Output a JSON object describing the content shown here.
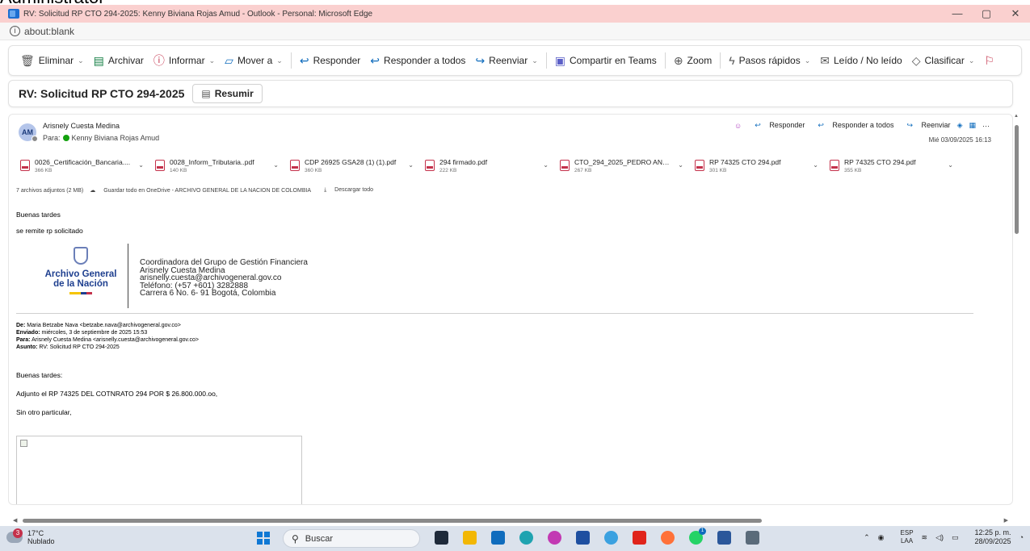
{
  "cutoff_text": "Administrator",
  "window": {
    "title": "RV: Solicitud RP CTO 294-2025: Kenny Biviana Rojas Amud - Outlook - Personal: Microsoft Edge",
    "address": "about:blank",
    "minimize": "—",
    "restore": "▢",
    "close": "✕"
  },
  "toolbar": {
    "delete": "Eliminar",
    "archive": "Archivar",
    "report": "Informar",
    "move": "Mover a",
    "reply": "Responder",
    "reply_all": "Responder a todos",
    "forward": "Reenviar",
    "teams": "Compartir en Teams",
    "zoom": "Zoom",
    "quick_steps": "Pasos rápidos",
    "read_unread": "Leído / No leído",
    "categorize": "Clasificar"
  },
  "subject": "RV: Solicitud RP CTO 294-2025",
  "summarize_label": "Resumir",
  "message": {
    "avatar": "AM",
    "sender": "Arisnely Cuesta Medina",
    "to_prefix": "Para:",
    "to": "Kenny Biviana Rojas Amud",
    "date": "Mié 03/09/2025 16:13",
    "actions": {
      "reply": "Responder",
      "reply_all": "Responder a todos",
      "forward": "Reenviar"
    }
  },
  "attachments": [
    {
      "name": "0026_Certificación_Bancaria....",
      "size": "366 KB"
    },
    {
      "name": "0028_Inform_Tributaria..pdf",
      "size": "140 KB"
    },
    {
      "name": "CDP 26925 GSA28 (1) (1).pdf",
      "size": "360 KB"
    },
    {
      "name": "294 firmado.pdf",
      "size": "222 KB"
    },
    {
      "name": "CTO_294_2025_PEDRO AND...",
      "size": "267 KB"
    },
    {
      "name": "RP 74325 CTO 294.pdf",
      "size": "301 KB"
    },
    {
      "name": "RP 74325 CTO 294.pdf",
      "size": "355 KB"
    }
  ],
  "attachment_summary": {
    "count": "7 archivos adjuntos (2 MB)",
    "save": "Guardar todo en OneDrive - ARCHIVO GENERAL DE LA NACION DE COLOMBIA",
    "download": "Descargar todo"
  },
  "body": {
    "greeting": "Buenas tardes",
    "line1": "se remite rp solicitado"
  },
  "signature": {
    "logo_line1": "Archivo General",
    "logo_line2": "de la Nación",
    "role": "Coordinadora del Grupo de Gestión Financiera",
    "name": "Arisnely Cuesta Medina",
    "email": "arisnelly.cuesta@archivogeneral.gov.co",
    "phone": "Teléfono: (+57 +601) 3282888",
    "address": "Carrera 6 No. 6- 91 Bogotá, Colombia"
  },
  "forwarded": {
    "from_label": "De:",
    "from": "Maria Betzabe Nava <betzabe.nava@archivogeneral.gov.co>",
    "sent_label": "Enviado:",
    "sent": "miércoles, 3 de septiembre de 2025 15:53",
    "to_label": "Para:",
    "to": "Arisnely Cuesta Medina <arisnelly.cuesta@archivogeneral.gov.co>",
    "subject_label": "Asunto:",
    "subject": "RV: Solicitud RP CTO 294-2025",
    "greeting": "Buenas tardes:",
    "line1": "Adjunto el RP 74325 DEL COTNRATO 294 POR $ 26.800.000.oo,",
    "closing": "Sin otro particular,"
  },
  "taskbar": {
    "temp": "17°C",
    "weather": "Nublado",
    "weather_badge": "3",
    "search": "Buscar",
    "lang_top": "ESP",
    "lang_bottom": "LAA",
    "time": "12:25 p. m.",
    "date": "28/09/2025"
  },
  "colors": {
    "titlebar": "#fad0cf",
    "accent": "#0f6cbd",
    "taskbar": "#dbe2ec"
  }
}
